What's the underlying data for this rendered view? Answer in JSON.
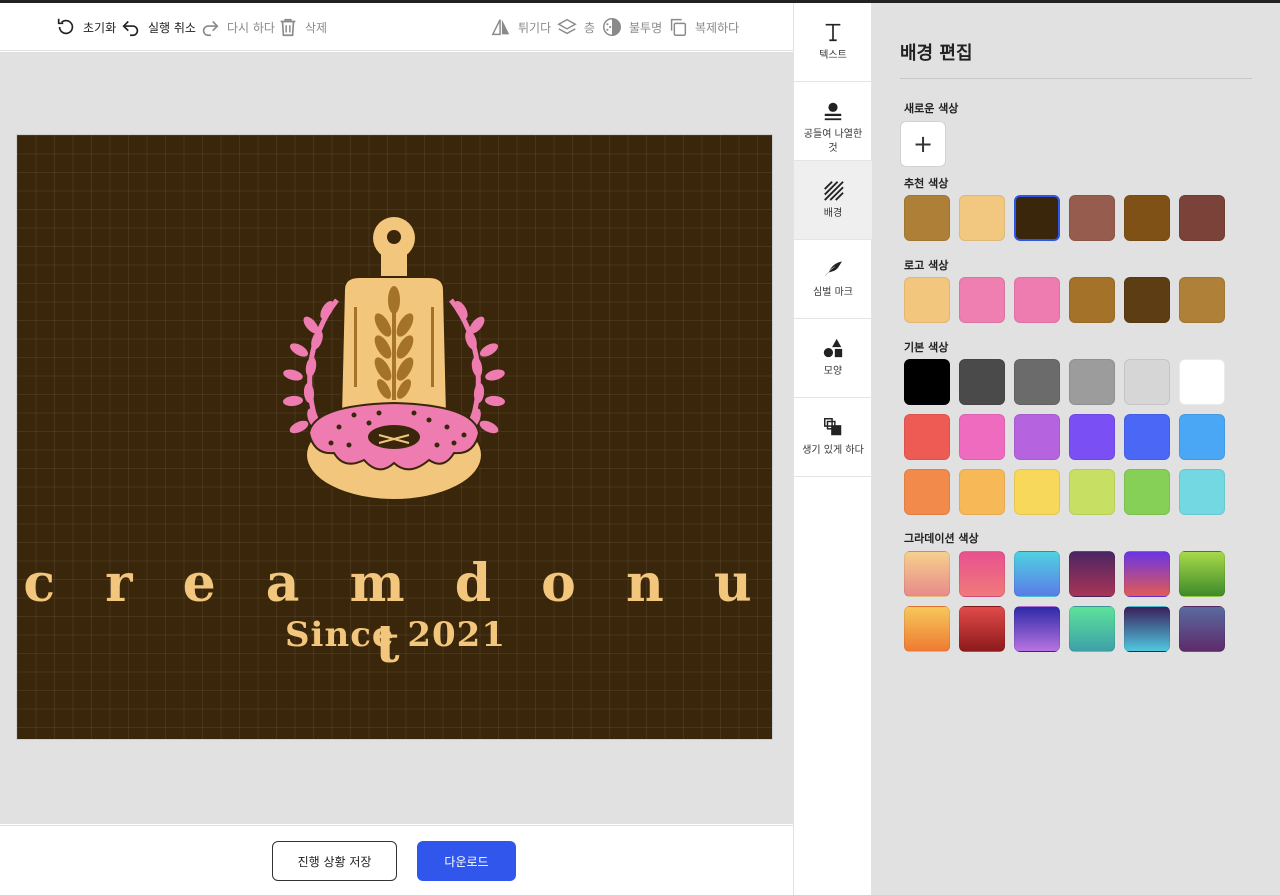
{
  "toolbar": {
    "reset": "초기화",
    "undo": "실행 취소",
    "redo": "다시 하다",
    "delete": "삭제",
    "flip": "튀기다",
    "layer": "층",
    "opacity": "불투명",
    "duplicate": "복제하다"
  },
  "canvas": {
    "background_color": "#3a260a",
    "brand_name": "c r e a m   d o n u t",
    "slogan": "Since 2021",
    "text_color": "#f2c67c"
  },
  "bottom": {
    "save_label": "진행 상황 저장",
    "download_label": "다운로드"
  },
  "side_tools": [
    {
      "label": "텍스트",
      "icon": "text-icon"
    },
    {
      "label": "공들여 나열한 것",
      "icon": "align-icon"
    },
    {
      "label": "배경",
      "icon": "background-icon"
    },
    {
      "label": "심벌 마크",
      "icon": "symbol-icon"
    },
    {
      "label": "모양",
      "icon": "shapes-icon"
    },
    {
      "label": "생기 있게 하다",
      "icon": "animate-icon"
    }
  ],
  "panel": {
    "title": "배경 편집",
    "new_color_label": "새로운 색상",
    "recommended_label": "추천 색상",
    "logo_label": "로고 색상",
    "basic_label": "기본 색상",
    "gradient_label": "그라데이션 색상",
    "recommended_colors": [
      "#ad7f37",
      "#f2c780",
      "#3a260a",
      "#965c4e",
      "#7f5117",
      "#7a4238"
    ],
    "selected_recommended_index": 2,
    "logo_colors": [
      "#f2c67c",
      "#ee7fb0",
      "#ef7cb1",
      "#a47228",
      "#5c3d14",
      "#ae8038"
    ],
    "basic_colors": [
      [
        "#000000",
        "#4a4a4a",
        "#6b6b6b",
        "#9c9c9c",
        "#d6d6d6",
        "#ffffff"
      ],
      [
        "#ee5b54",
        "#ee6bbf",
        "#b663e0",
        "#7a4ff3",
        "#4a68f5",
        "#4aa7f5"
      ],
      [
        "#f18a4a",
        "#f7b957",
        "#f8d85a",
        "#c7e063",
        "#86d058",
        "#74d8e2"
      ]
    ],
    "gradient_colors": [
      [
        [
          "#f5d08d",
          "#e98a8a"
        ],
        [
          "#e8518f",
          "#f07a7a"
        ],
        [
          "#4fd2df",
          "#5b7be9"
        ],
        [
          "#4b2663",
          "#a93456"
        ],
        [
          "#6a35e3",
          "#e25a55"
        ],
        [
          "#a7d94a",
          "#3f8a2a"
        ]
      ],
      [
        [
          "#f7c85a",
          "#ef7a32"
        ],
        [
          "#e04a4a",
          "#8e1a1a"
        ],
        [
          "#2e2aa8",
          "#b873e0"
        ],
        [
          "#5ce29a",
          "#3fa0a8"
        ],
        [
          "#3a1f5c",
          "#4fc9e0"
        ],
        [
          "#5a6aa0",
          "#5e2b6a"
        ]
      ]
    ]
  }
}
